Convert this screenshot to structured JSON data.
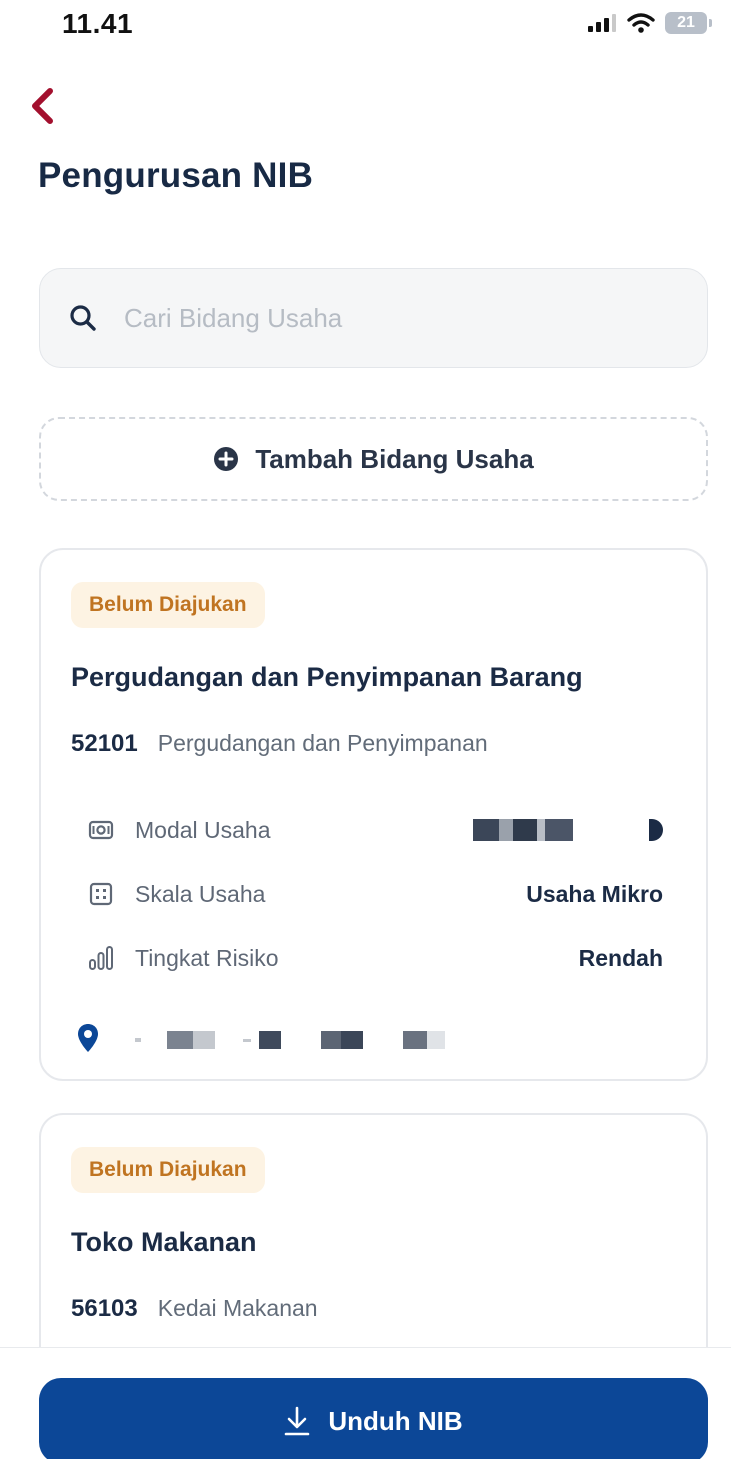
{
  "status_bar": {
    "time": "11.41",
    "battery_level": "21"
  },
  "header": {
    "title": "Pengurusan NIB"
  },
  "search": {
    "placeholder": "Cari Bidang Usaha",
    "value": ""
  },
  "add_button": {
    "label": "Tambah Bidang Usaha"
  },
  "cards": [
    {
      "status": "Belum Diajukan",
      "title": "Pergudangan dan Penyimpanan Barang",
      "kbli_code": "52101",
      "kbli_desc": "Pergudangan dan Penyimpanan",
      "details": [
        {
          "label": "Modal Usaha",
          "value": ""
        },
        {
          "label": "Skala Usaha",
          "value": "Usaha Mikro"
        },
        {
          "label": "Tingkat Risiko",
          "value": "Rendah"
        }
      ]
    },
    {
      "status": "Belum Diajukan",
      "title": "Toko Makanan",
      "kbli_code": "56103",
      "kbli_desc": "Kedai Makanan"
    }
  ],
  "footer": {
    "download_label": "Unduh NIB"
  },
  "colors": {
    "primary": "#0c4797",
    "back_arrow": "#a3102e",
    "badge_bg": "#fdf3e3",
    "badge_text": "#c07421",
    "title_text": "#182a45"
  },
  "icons": {
    "back": "chevron-left-icon",
    "search": "search-icon",
    "add": "plus-circle-icon",
    "modal": "money-icon",
    "skala": "grid-icon",
    "risiko": "bar-chart-icon",
    "location": "location-pin-icon",
    "download": "download-icon"
  }
}
